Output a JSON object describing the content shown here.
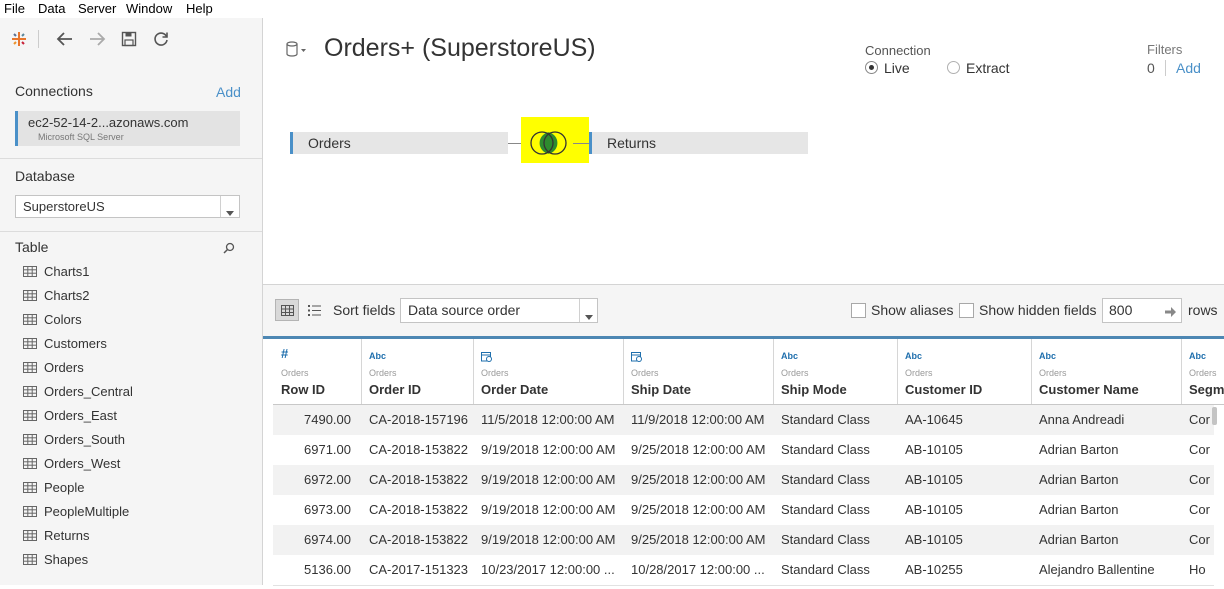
{
  "menu": [
    "File",
    "Data",
    "Server",
    "Window",
    "Help"
  ],
  "sidebar": {
    "connections_title": "Connections",
    "add_label": "Add",
    "connection": {
      "name": "ec2-52-14-2...azonaws.com",
      "type": "Microsoft SQL Server"
    },
    "database_title": "Database",
    "database_value": "SuperstoreUS",
    "table_title": "Table",
    "tables": [
      "Charts1",
      "Charts2",
      "Colors",
      "Customers",
      "Orders",
      "Orders_Central",
      "Orders_East",
      "Orders_South",
      "Orders_West",
      "People",
      "PeopleMultiple",
      "Returns",
      "Shapes"
    ]
  },
  "header": {
    "title": "Orders+ (SuperstoreUS)",
    "connection_label": "Connection",
    "live_label": "Live",
    "extract_label": "Extract",
    "selected_connection": "Live",
    "filters_label": "Filters",
    "filters_count": "0",
    "filters_add": "Add"
  },
  "join": {
    "left_table": "Orders",
    "right_table": "Returns",
    "highlight_color": "#ffff00",
    "join_type": "inner"
  },
  "grid_toolbar": {
    "sort_label": "Sort fields",
    "sort_value": "Data source order",
    "show_aliases": "Show aliases",
    "show_hidden": "Show hidden fields",
    "rows_value": "800",
    "rows_label": "rows"
  },
  "columns": [
    {
      "type": "#",
      "source": "Orders",
      "name": "Row ID"
    },
    {
      "type": "Abc",
      "source": "Orders",
      "name": "Order ID"
    },
    {
      "type": "date",
      "source": "Orders",
      "name": "Order Date"
    },
    {
      "type": "date",
      "source": "Orders",
      "name": "Ship Date"
    },
    {
      "type": "Abc",
      "source": "Orders",
      "name": "Ship Mode"
    },
    {
      "type": "Abc",
      "source": "Orders",
      "name": "Customer ID"
    },
    {
      "type": "Abc",
      "source": "Orders",
      "name": "Customer Name"
    },
    {
      "type": "Abc",
      "source": "Orders",
      "name": "Segm"
    }
  ],
  "rows": [
    [
      "7490.00",
      "CA-2018-157196",
      "11/5/2018 12:00:00 AM",
      "11/9/2018 12:00:00 AM",
      "Standard Class",
      "AA-10645",
      "Anna Andreadi",
      "Cor"
    ],
    [
      "6971.00",
      "CA-2018-153822",
      "9/19/2018 12:00:00 AM",
      "9/25/2018 12:00:00 AM",
      "Standard Class",
      "AB-10105",
      "Adrian Barton",
      "Cor"
    ],
    [
      "6972.00",
      "CA-2018-153822",
      "9/19/2018 12:00:00 AM",
      "9/25/2018 12:00:00 AM",
      "Standard Class",
      "AB-10105",
      "Adrian Barton",
      "Cor"
    ],
    [
      "6973.00",
      "CA-2018-153822",
      "9/19/2018 12:00:00 AM",
      "9/25/2018 12:00:00 AM",
      "Standard Class",
      "AB-10105",
      "Adrian Barton",
      "Cor"
    ],
    [
      "6974.00",
      "CA-2018-153822",
      "9/19/2018 12:00:00 AM",
      "9/25/2018 12:00:00 AM",
      "Standard Class",
      "AB-10105",
      "Adrian Barton",
      "Cor"
    ],
    [
      "5136.00",
      "CA-2017-151323",
      "10/23/2017 12:00:00 ...",
      "10/28/2017 12:00:00 ...",
      "Standard Class",
      "AB-10255",
      "Alejandro Ballentine",
      "Ho"
    ]
  ],
  "colors": {
    "accent": "#1f77b4",
    "link": "#4a90c8",
    "sidebar_bg": "#f5f5f5"
  }
}
